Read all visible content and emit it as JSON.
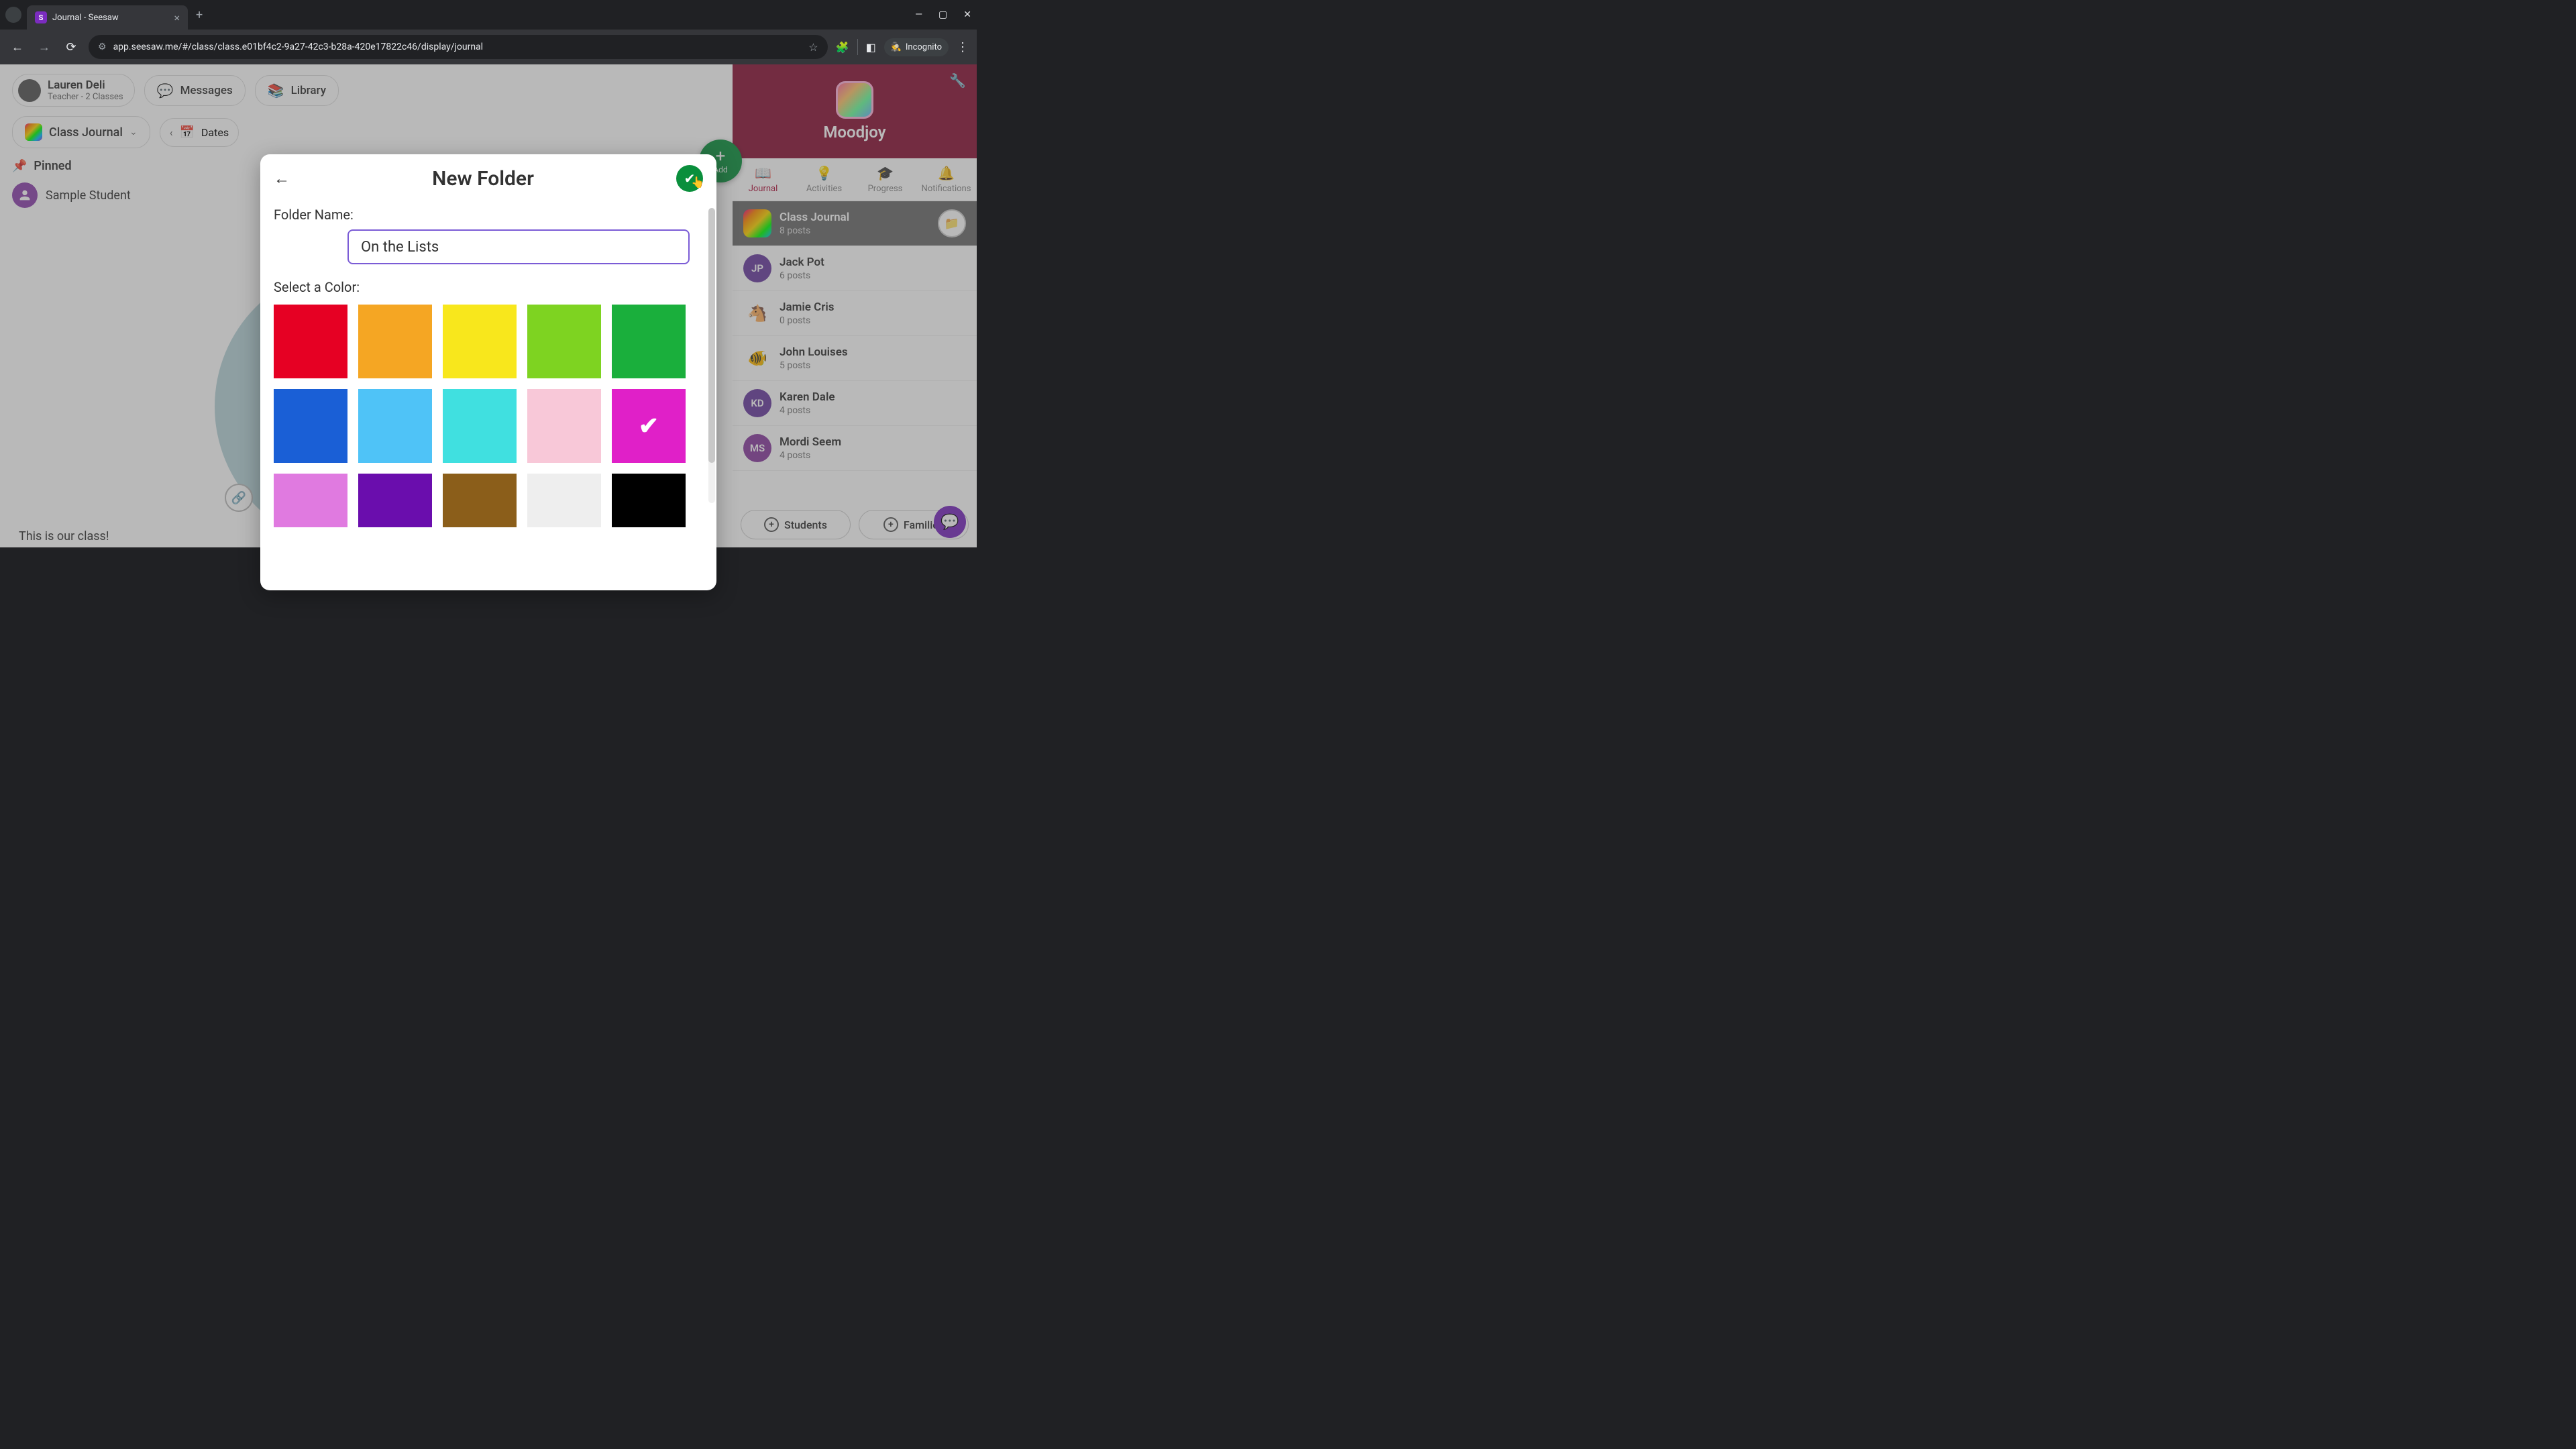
{
  "browser": {
    "tab_title": "Journal - Seesaw",
    "url": "app.seesaw.me/#/class/class.e01bf4c2-9a27-42c3-b28a-420e17822c46/display/journal",
    "incognito_label": "Incognito"
  },
  "header": {
    "user_name": "Lauren Deli",
    "user_sub": "Teacher - 2 Classes",
    "messages_label": "Messages",
    "library_label": "Library",
    "add_label": "Add"
  },
  "section": {
    "class_journal_label": "Class Journal",
    "dates_label": "Dates"
  },
  "pinned": {
    "label": "Pinned",
    "student": "Sample Student"
  },
  "caption": "This is our class!",
  "sidebar": {
    "class_name": "Moodjoy",
    "tabs": [
      {
        "label": "Journal",
        "icon": "📖"
      },
      {
        "label": "Activities",
        "icon": "💡"
      },
      {
        "label": "Progress",
        "icon": "🎓"
      },
      {
        "label": "Notifications",
        "icon": "🔔"
      }
    ],
    "items": [
      {
        "name": "Class Journal",
        "sub": "8 posts",
        "avatar_type": "rainbow",
        "initials": ""
      },
      {
        "name": "Jack Pot",
        "sub": "6 posts",
        "avatar_type": "initials",
        "initials": "JP",
        "color": "#6b3fa0"
      },
      {
        "name": "Jamie Cris",
        "sub": "0 posts",
        "avatar_type": "emoji",
        "initials": "🐴",
        "color": "#d4a574"
      },
      {
        "name": "John Louises",
        "sub": "5 posts",
        "avatar_type": "emoji",
        "initials": "🐠",
        "color": "#6bb5d6"
      },
      {
        "name": "Karen Dale",
        "sub": "4 posts",
        "avatar_type": "initials",
        "initials": "KD",
        "color": "#6b3fa0"
      },
      {
        "name": "Mordi Seem",
        "sub": "4 posts",
        "avatar_type": "initials",
        "initials": "MS",
        "color": "#8b3fa0"
      }
    ],
    "students_btn": "Students",
    "families_btn": "Families"
  },
  "modal": {
    "title": "New Folder",
    "name_label": "Folder Name:",
    "name_value": "On the Lists",
    "color_label": "Select a Color:",
    "colors": [
      "#e60023",
      "#f5a623",
      "#f8e71c",
      "#7ed321",
      "#1aaf3c",
      "#1a5fd6",
      "#4fc3f7",
      "#40e0e0",
      "#f8c8d8",
      "#e020c8",
      "#e07ae0",
      "#6a0dad",
      "#8b5e1a",
      "#eeeeee",
      "#000000"
    ],
    "selected_color_index": 9
  }
}
